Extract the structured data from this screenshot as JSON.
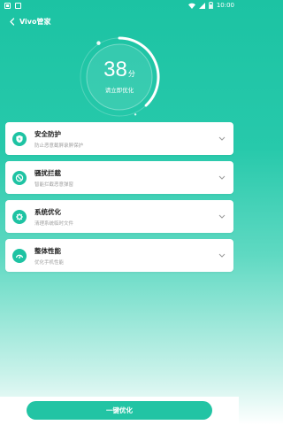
{
  "status_bar": {
    "time": "10:00"
  },
  "header": {
    "title": "Vivo管家"
  },
  "score": {
    "value": "38",
    "unit": "分",
    "subtitle": "请立即优化",
    "progress_fraction": 0.38
  },
  "cards": [
    {
      "title": "安全防护",
      "desc": "防止恶意截屏录屏保护",
      "icon": "shield-bolt-icon"
    },
    {
      "title": "骚扰拦截",
      "desc": "智能拦截恶意弹窗",
      "icon": "block-icon"
    },
    {
      "title": "系统优化",
      "desc": "清理系统临时文件",
      "icon": "gear-cleanup-icon"
    },
    {
      "title": "整体性能",
      "desc": "优化手机性能",
      "icon": "speedometer-icon"
    }
  ],
  "action": {
    "label": "一键优化"
  },
  "colors": {
    "accent": "#22c4a4",
    "background_top": "#1cc3a3",
    "card_bg": "#ffffff"
  }
}
